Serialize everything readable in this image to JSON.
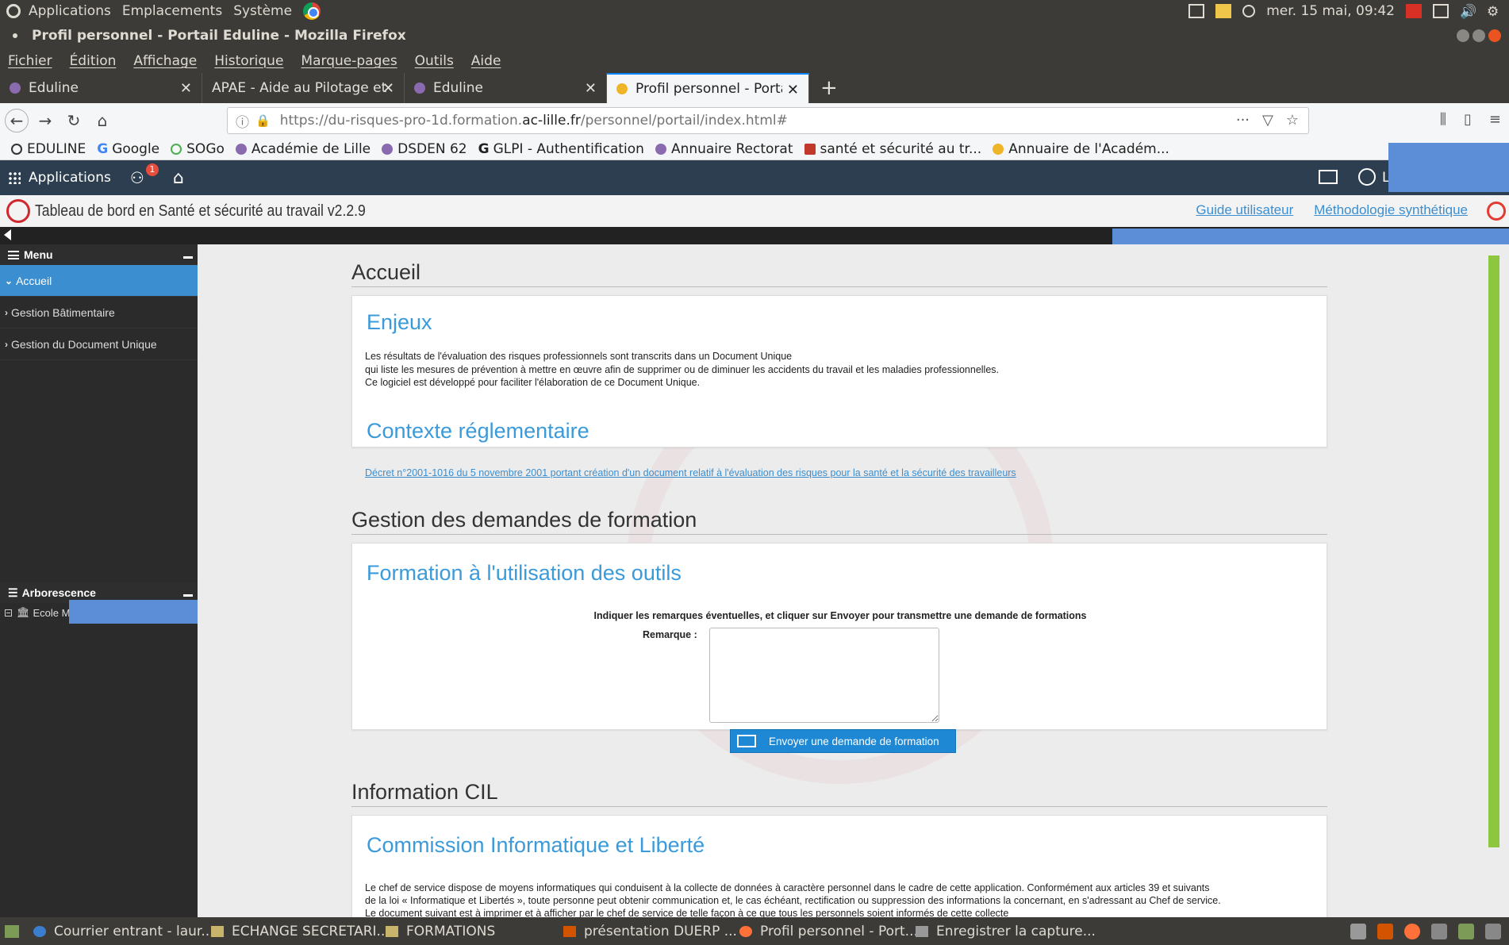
{
  "gnome_panel": {
    "menus": [
      "Applications",
      "Emplacements",
      "Système"
    ],
    "clock": "mer. 15 mai, 09:42"
  },
  "firefox": {
    "window_title": "Profil personnel - Portail Eduline - Mozilla Firefox",
    "menubar": [
      "Fichier",
      "Édition",
      "Affichage",
      "Historique",
      "Marque-pages",
      "Outils",
      "Aide"
    ],
    "tabs": [
      {
        "label": "Eduline",
        "active": false
      },
      {
        "label": "APAE - Aide au Pilotage et à",
        "active": false
      },
      {
        "label": "Eduline",
        "active": false
      },
      {
        "label": "Profil personnel - Portail",
        "active": true
      }
    ],
    "url": {
      "prefix": "https://du-risques-pro-1d.formation.",
      "domain": "ac-lille.fr",
      "path": "/personnel/portail/index.html#"
    },
    "bookmarks": [
      "EDULINE",
      "Google",
      "SOGo",
      "Académie de Lille",
      "DSDEN 62",
      "GLPI - Authentification",
      "Annuaire Rectorat",
      "santé et sécurité au tr...",
      "Annuaire de l'Académ..."
    ]
  },
  "eduline_header": {
    "apps_label": "Applications",
    "notification_count": "1",
    "user_initial": "L"
  },
  "app_bar": {
    "title": "Tableau de bord en Santé et sécurité au travail v2.2.9",
    "links": [
      "Guide utilisateur",
      "Méthodologie synthétique"
    ]
  },
  "sidebar": {
    "menu_title": "Menu",
    "items": [
      {
        "label": "Accueil",
        "active": true
      },
      {
        "label": "Gestion Bâtimentaire",
        "active": false
      },
      {
        "label": "Gestion du Document Unique",
        "active": false
      }
    ],
    "tree_title": "Arborescence",
    "tree_root": "Ecole M"
  },
  "main": {
    "accueil": {
      "section_title": "Accueil",
      "enjeux_title": "Enjeux",
      "enjeux_lines": [
        "Les résultats  de l'évaluation des risques professionnels sont transcrits dans un Document Unique",
        "qui liste les mesures de prévention à mettre en œuvre afin de supprimer ou de diminuer les accidents du travail et les maladies professionnelles.",
        "Ce logiciel est développé pour faciliter l'élaboration de ce Document Unique."
      ],
      "contexte_title": "Contexte réglementaire",
      "decret_link": "Décret n°2001-1016 du 5 novembre 2001 portant création d'un document relatif à l'évaluation des risques pour la santé et la sécurité des travailleurs"
    },
    "formation": {
      "section_title": "Gestion des demandes de formation",
      "card_title": "Formation à l'utilisation des outils",
      "instructions": "Indiquer les remarques éventuelles, et cliquer sur Envoyer pour transmettre une demande de formations",
      "remark_label": "Remarque :",
      "remark_value": "",
      "send_button": "Envoyer une demande de formation"
    },
    "cil": {
      "section_title": "Information CIL",
      "card_title": "Commission Informatique et Liberté",
      "lines": [
        "Le chef de service dispose de moyens informatiques qui conduisent à la collecte de données à caractère personnel dans le cadre de cette application. Conformément aux articles 39 et suivants",
        "de la loi « Informatique et Libertés », toute personne peut obtenir communication et, le cas échéant, rectification ou suppression des informations la concernant, en s'adressant au Chef de service.",
        "Le document suivant est à imprimer et à afficher par le chef de service de telle façon à ce que tous les personnels soient informés de cette collecte"
      ]
    }
  },
  "taskbar": {
    "items": [
      "Courrier entrant - laur...",
      "ECHANGE SECRETARI...",
      "FORMATIONS",
      "présentation DUERP ...",
      "Profil personnel - Port...",
      "Enregistrer la capture..."
    ]
  },
  "colors": {
    "accent": "#3b8ed0",
    "heading_blue": "#3b9ad9",
    "header_dark": "#2c3e50",
    "scroll_green": "#8dc63f",
    "redaction": "#5b8ed6"
  }
}
